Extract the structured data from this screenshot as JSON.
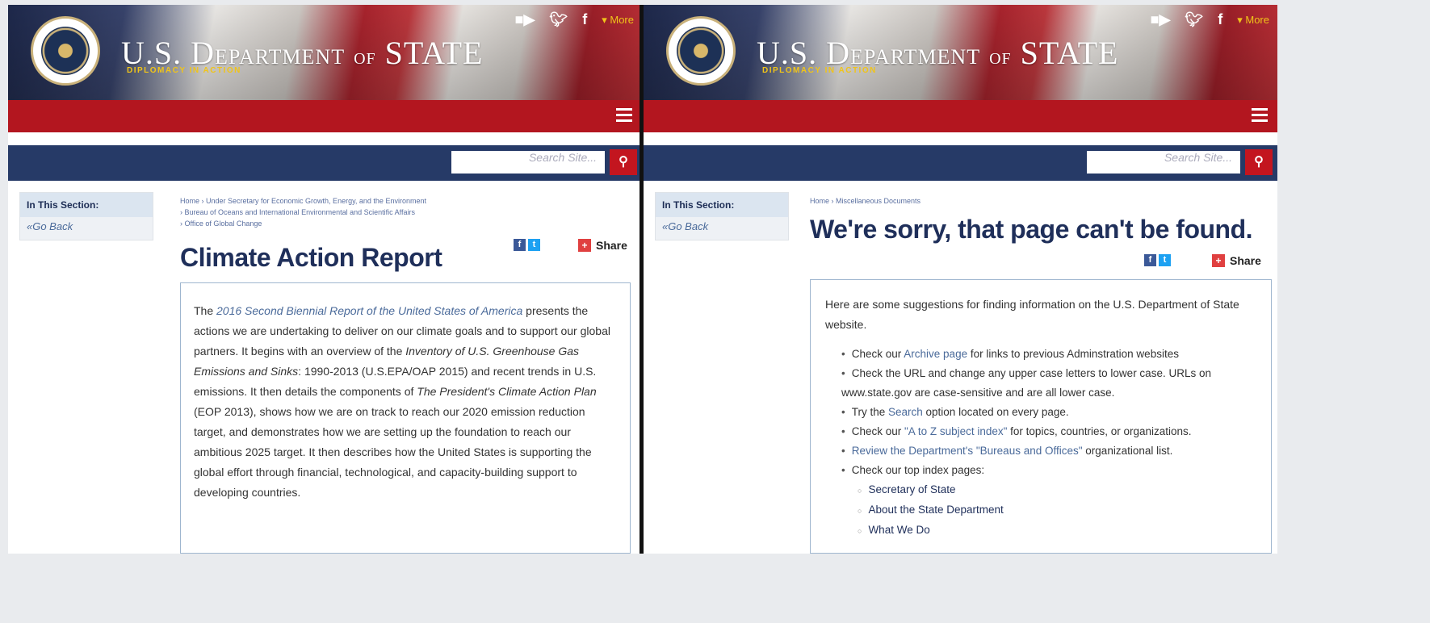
{
  "header": {
    "dept_main": "U.S. D",
    "dept_word1": "EPARTMENT",
    "dept_of": "OF",
    "dept_word2": "STATE",
    "tagline": "DIPLOMACY IN ACTION",
    "more_label": "▾ More"
  },
  "search": {
    "placeholder": "Search Site..."
  },
  "sidebar": {
    "heading": "In This Section:",
    "back_label": "«Go Back"
  },
  "share_label": "Share",
  "left": {
    "breadcrumb": [
      "Home  ›  Under Secretary for Economic Growth, Energy, and the Environment",
      "  ›  Bureau of Oceans and International Environmental and Scientific Affairs",
      "  ›  Office of Global Change"
    ],
    "title": "Climate Action Report",
    "paragraph": {
      "p1_prefix": "The ",
      "p1_italic": "2016 Second Biennial Report of the United States of America",
      "p2": " presents the actions we are undertaking to deliver on our climate goals and to support our global partners. It begins with an overview of the ",
      "p3_italic": "Inventory of U.S. Greenhouse Gas Emissions and Sinks",
      "p4": ": 1990-2013 (U.S.EPA/OAP 2015) and recent trends in U.S. emissions. It then details the components of ",
      "p5_italic": "The President's Climate Action Plan",
      "p6": " (EOP 2013), shows how we are on track to reach our 2020 emission reduction target, and demonstrates how we are setting up the foundation to reach our ambitious 2025 target. It then describes how the United States is supporting the global effort through financial, technological, and capacity-building support to developing countries."
    }
  },
  "right": {
    "breadcrumb": "Home  ›  Miscellaneous Documents",
    "title": "We're sorry, that page can't be found.",
    "intro": "Here are some suggestions for finding information on the U.S. Department of State website.",
    "bullets": {
      "b1_pre": "Check our ",
      "b1_link": "Archive page",
      "b1_post": " for links to previous Adminstration websites",
      "b2": "Check the URL and change any upper case letters to lower case. URLs on www.state.gov are case-sensitive and are all lower case.",
      "b3_pre": "Try the ",
      "b3_link": "Search",
      "b3_post": " option located on every page.",
      "b4_pre": "Check our ",
      "b4_link": "\"A to Z subject index\"",
      "b4_post": " for topics, countries, or organizations.",
      "b5_link": "Review the Department's \"Bureaus and Offices\"",
      "b5_post": " organizational list.",
      "b6": "Check our top index pages:"
    },
    "sub_items": [
      "Secretary of State",
      "About the State Department",
      "What We Do"
    ]
  }
}
